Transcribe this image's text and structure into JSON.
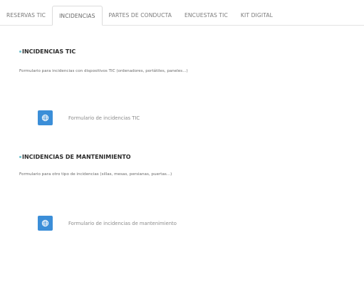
{
  "tabs": [
    {
      "label": "RESERVAS TIC"
    },
    {
      "label": "INCIDENCIAS"
    },
    {
      "label": "PARTES DE CONDUCTA"
    },
    {
      "label": "ENCUESTAS TIC"
    },
    {
      "label": "KIT DIGITAL"
    }
  ],
  "active_tab": 1,
  "sections": [
    {
      "title": "INCIDENCIAS TIC",
      "description": "Formulario para incidencias con dispositivos TIC (ordenadores, portátiles, paneles...)",
      "link_label": "Formulario de incidencias TIC",
      "icon": "globe-icon"
    },
    {
      "title": "INCIDENCIAS DE MANTENIMIENTO",
      "description": "Formulario para otro tipo de incidencias (sillas, mesas, persianas, puertas...)",
      "link_label": "Formulario de incidencias de mantenimiento",
      "icon": "globe-icon"
    }
  ],
  "colors": {
    "accent": "#3b8ed8",
    "bullet": "#6ec1cf"
  }
}
